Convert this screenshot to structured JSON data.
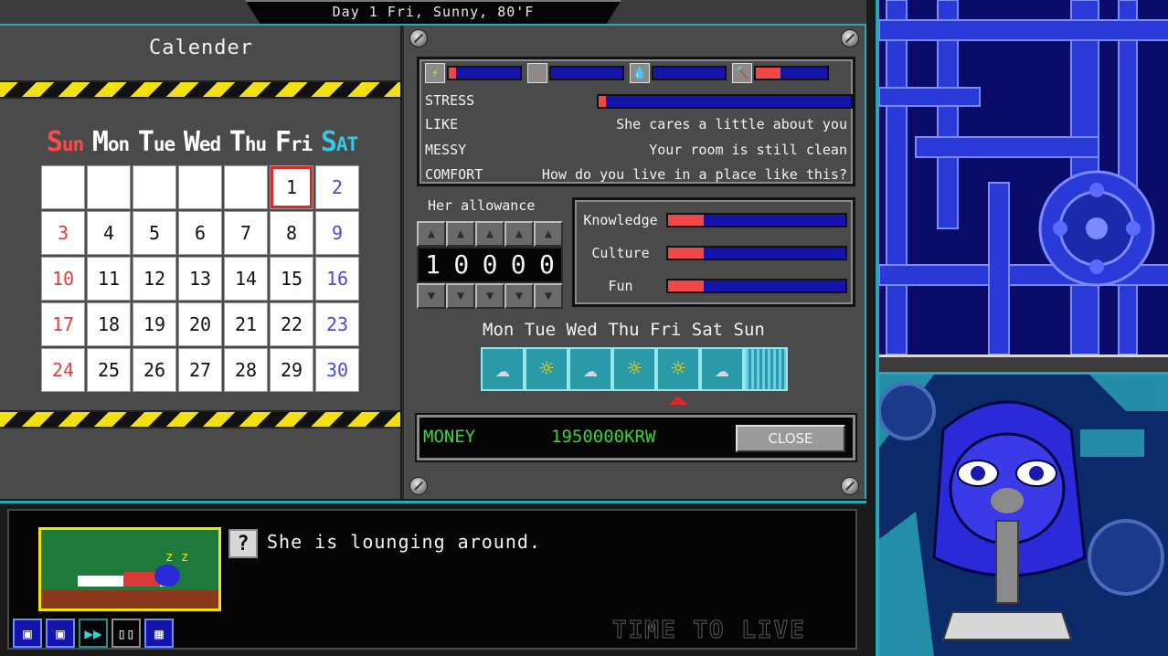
{
  "header": {
    "day_text": "Day 1 Fri, Sunny, 80'F"
  },
  "calendar": {
    "title": "Calender",
    "weekdays": [
      {
        "first": "S",
        "rest": "un"
      },
      {
        "first": "M",
        "rest": "on"
      },
      {
        "first": "T",
        "rest": "ue"
      },
      {
        "first": "W",
        "rest": "ed"
      },
      {
        "first": "T",
        "rest": "hu"
      },
      {
        "first": "F",
        "rest": "ri"
      },
      {
        "first": "S",
        "rest": "AT"
      }
    ],
    "cells": [
      "",
      "",
      "",
      "",
      "",
      "1",
      "2",
      "3",
      "4",
      "5",
      "6",
      "7",
      "8",
      "9",
      "10",
      "11",
      "12",
      "13",
      "14",
      "15",
      "16",
      "17",
      "18",
      "19",
      "20",
      "21",
      "22",
      "23",
      "24",
      "25",
      "26",
      "27",
      "28",
      "29",
      "30"
    ],
    "today": "1"
  },
  "stats": {
    "meters": [
      {
        "icon": "lightning-icon",
        "glyph": "⚡",
        "level": 0.1
      },
      {
        "icon": "fire-icon",
        "glyph": "♨",
        "level": 0
      },
      {
        "icon": "water-drop-icon",
        "glyph": "💧",
        "level": 0
      },
      {
        "icon": "hammer-icon",
        "glyph": "🔨",
        "level": 0.35
      }
    ],
    "stress": {
      "label": "STRESS",
      "level": 0.03
    },
    "like": {
      "label": "LIKE",
      "value": "She cares a little about you"
    },
    "messy": {
      "label": "MESSY",
      "value": "Your room is still clean"
    },
    "comfort": {
      "label": "COMFORT",
      "value": "How do you live in a place like this?"
    }
  },
  "allowance": {
    "label": "Her allowance",
    "digits": [
      "1",
      "0",
      "0",
      "0",
      "0"
    ]
  },
  "attributes": [
    {
      "label": "Knowledge",
      "level": 0.2
    },
    {
      "label": "Culture",
      "level": 0.2
    },
    {
      "label": "Fun",
      "level": 0.2
    }
  ],
  "forecast": {
    "days": "Mon Tue Wed Thu Fri Sat Sun",
    "weather": [
      "cloudy",
      "sunny",
      "cloudy",
      "sunny",
      "sunny",
      "cloudy",
      "rainy"
    ],
    "current_index": 4
  },
  "money": {
    "label": "MONEY",
    "value": "1950000KRW",
    "close_label": "CLOSE"
  },
  "message": {
    "text": "She is lounging around.",
    "icon_glyph": "?",
    "sleep_glyph": "z z"
  },
  "toolbar": [
    {
      "icon": "save-icon",
      "glyph": "▣"
    },
    {
      "icon": "load-icon",
      "glyph": "▣"
    },
    {
      "icon": "fast-forward-icon",
      "glyph": "▶▶"
    },
    {
      "icon": "book-icon",
      "glyph": "▯▯"
    },
    {
      "icon": "calendar-icon",
      "glyph": "▦"
    }
  ],
  "watermark": "TIME TO LIVE",
  "colors": {
    "accent": "#2aa6b8",
    "bar_fill": "#f04848",
    "bar_bg": "#1414aa",
    "money_text": "#3ad23a"
  }
}
